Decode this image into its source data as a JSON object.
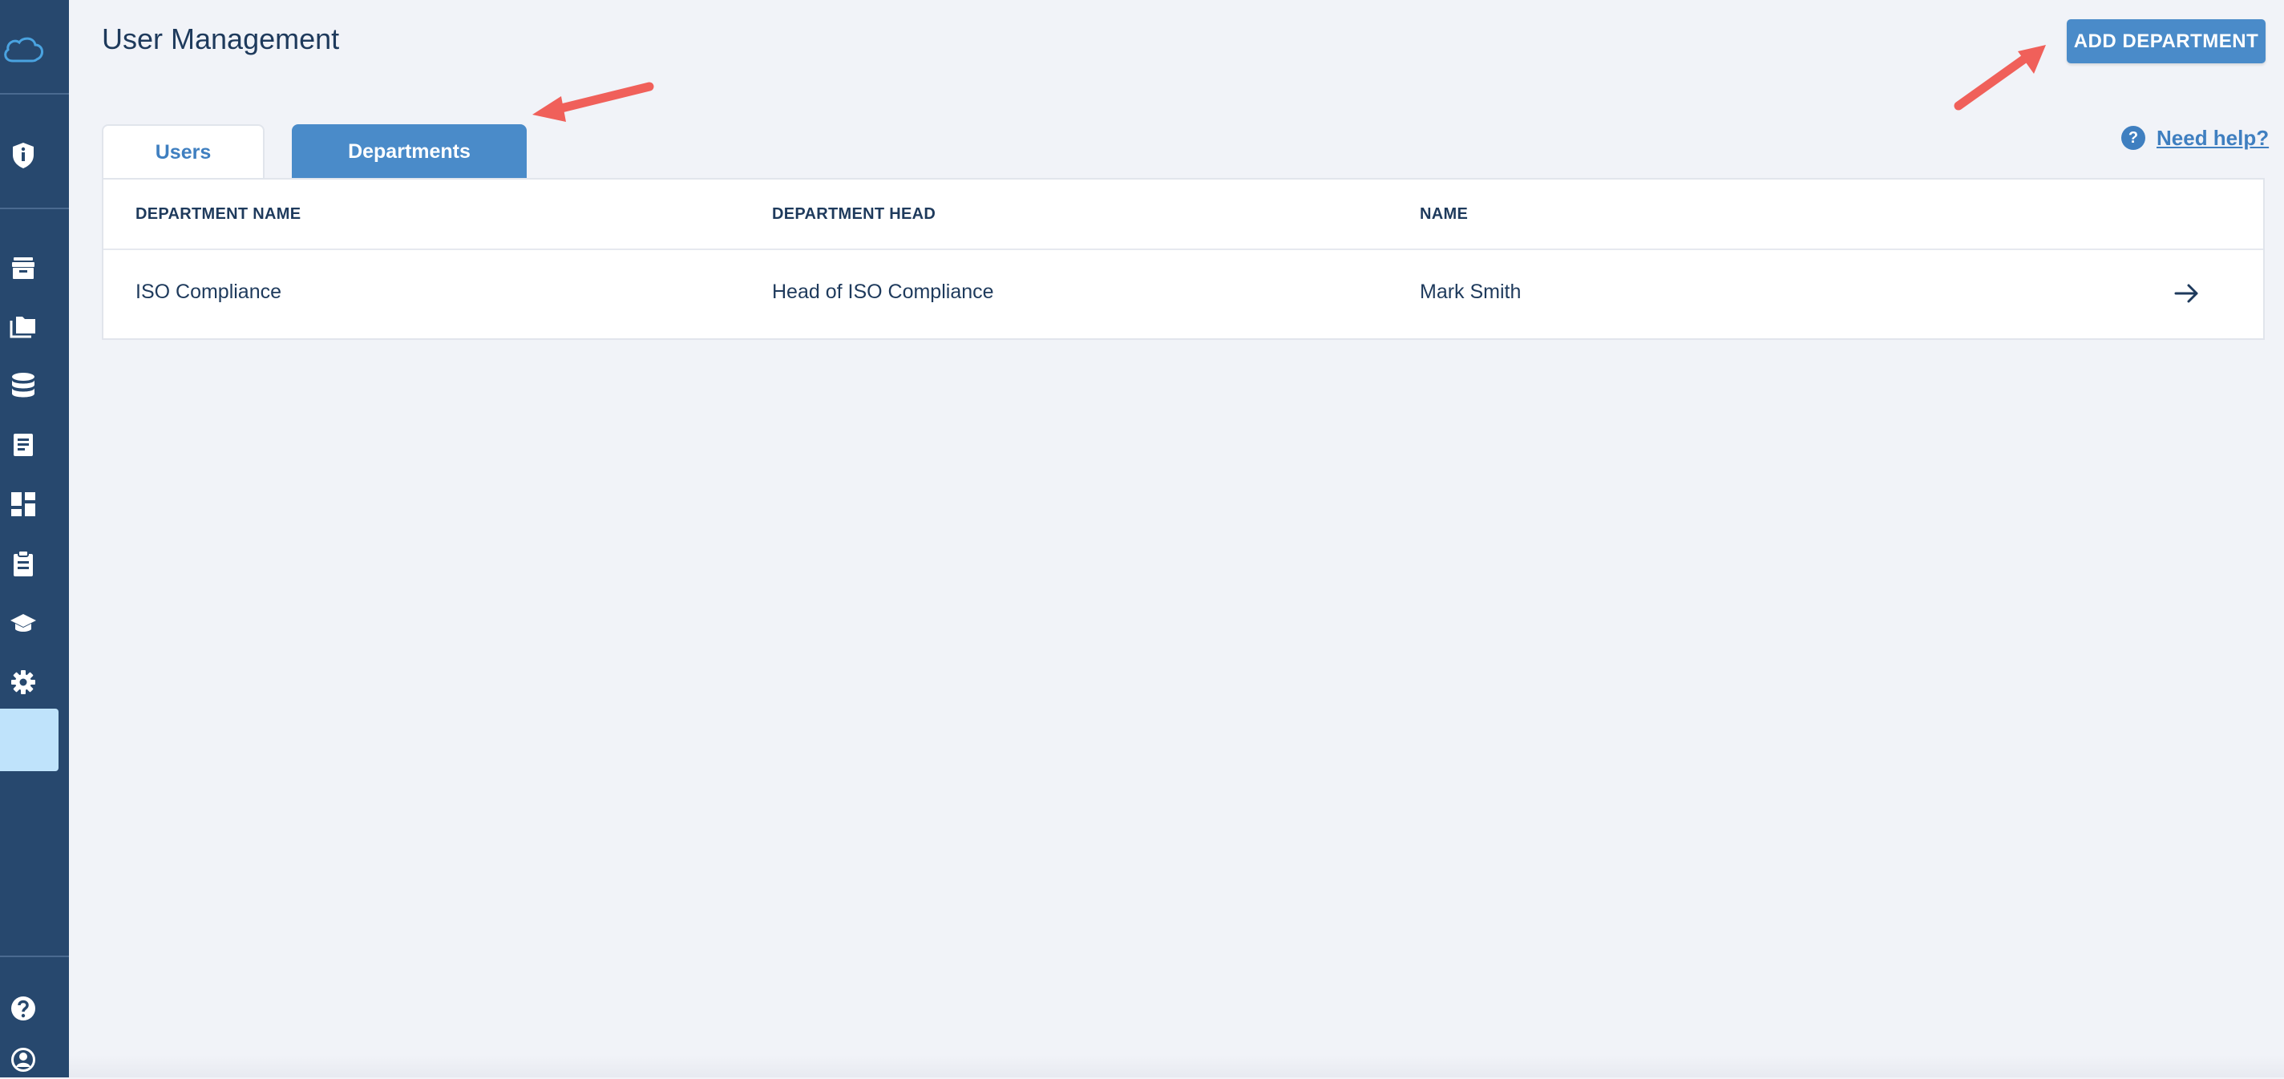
{
  "page": {
    "title": "User Management",
    "add_button": "ADD DEPARTMENT",
    "help_icon_glyph": "?",
    "help_link": "Need help?"
  },
  "sidebar": {
    "icons": [
      "cloud-logo-icon",
      "shield-icon",
      "archive-box-icon",
      "folders-icon",
      "database-icon",
      "document-list-icon",
      "dashboard-icon",
      "clipboard-icon",
      "graduation-cap-icon",
      "gear-icon",
      "help-circle-icon",
      "user-circle-icon"
    ],
    "active_item": "user-management"
  },
  "tabs": [
    {
      "label": "Users",
      "active": false
    },
    {
      "label": "Departments",
      "active": true
    }
  ],
  "table": {
    "headers": [
      "DEPARTMENT NAME",
      "DEPARTMENT HEAD",
      "NAME"
    ],
    "rows": [
      {
        "department_name": "ISO Compliance",
        "department_head": "Head of ISO Compliance",
        "name": "Mark Smith"
      }
    ]
  },
  "colors": {
    "sidebar_bg": "#27486e",
    "accent": "#4a8bc9",
    "active_sidebar": "#bfe3fb",
    "page_bg": "#f1f3f8",
    "annotation_arrow": "#f0605a"
  }
}
